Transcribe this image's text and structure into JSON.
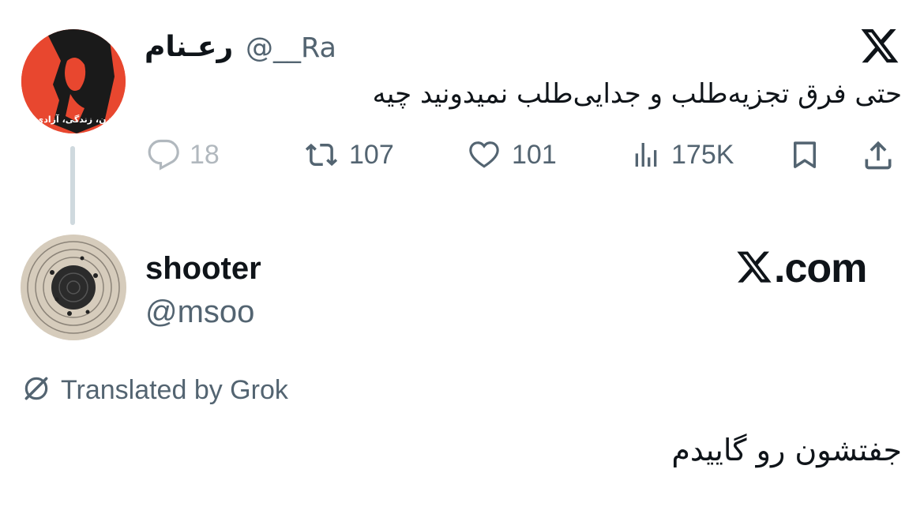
{
  "tweet1": {
    "display_name": "رعـنام",
    "handle": "@__Ra",
    "text": "حتی فرق تجزیه‌طلب و جدایی‌طلب نمیدونید چیه",
    "stats": {
      "replies": "18",
      "retweets": "107",
      "likes": "101",
      "views": "175K"
    },
    "avatar_caption": "زن، زندگی، آزادی",
    "icons": {
      "platform_logo": "x-logo-icon",
      "reply": "reply-icon",
      "retweet": "retweet-icon",
      "like": "heart-icon",
      "views": "views-icon",
      "bookmark": "bookmark-icon",
      "share": "share-icon"
    }
  },
  "tweet2": {
    "display_name": "shooter",
    "handle": "@msoo",
    "translation_note": "Translated by Grok",
    "text": "جفتشون رو گاییدم"
  },
  "watermark": {
    "label": ".com"
  },
  "colors": {
    "text_primary": "#0f1419",
    "text_secondary": "#536471",
    "thread_line": "#cfd9de",
    "avatar1_bg": "#e8472f"
  }
}
